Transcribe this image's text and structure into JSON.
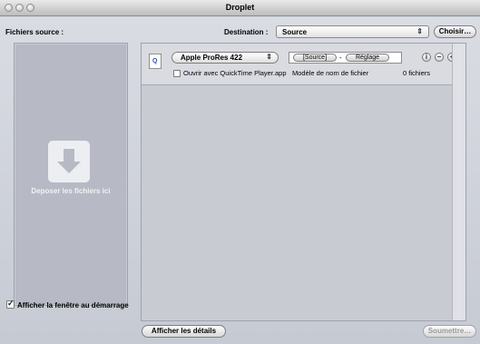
{
  "window": {
    "title": "Droplet"
  },
  "header": {
    "source_label": "Fichiers source :",
    "destination_label": "Destination :",
    "destination_value": "Source",
    "choose_label": "Choisir…"
  },
  "dropzone": {
    "text": "Deposer les fichiers ici"
  },
  "options": {
    "show_at_startup_label": "Afficher la fenêtre au démarrage",
    "show_at_startup_checked": true
  },
  "setting_row": {
    "preset": "Apple ProRes 422",
    "token_source": "[Source]",
    "token_separator": "-",
    "token_setting": "Réglage",
    "open_with_label": "Ouvrir avec QuickTime Player.app",
    "open_with_checked": false,
    "template_label": "Modèle de nom de fichier",
    "file_count": "0 fichiers"
  },
  "footer": {
    "details_label": "Afficher les détails",
    "submit_label": "Soumettre…"
  }
}
